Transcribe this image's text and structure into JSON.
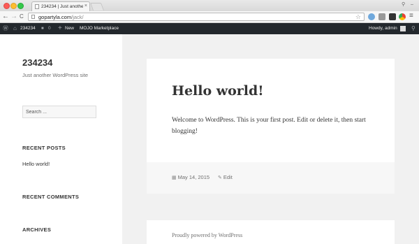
{
  "browser": {
    "tab_title": "234234 | Just another Wo",
    "tab_close": "×",
    "url_host": "gopartyla.com",
    "url_path": "/jack/",
    "back_glyph": "←",
    "forward_glyph": "→",
    "reload_glyph": "C",
    "star_glyph": "☆",
    "menu_glyph": "≡",
    "user_glyph": "⚲",
    "min_glyph": "–"
  },
  "admin_bar": {
    "site_name": "234234",
    "comments_count": "0",
    "new_label": "New",
    "new_plus": "+",
    "marketplace_label": "MOJO Marketplace",
    "howdy": "Howdy, admin",
    "wp_logo_glyph": "Ⓦ",
    "home_glyph": "⌂",
    "comment_glyph": "■",
    "search_glyph": "⚲"
  },
  "sidebar": {
    "site_title": "234234",
    "site_description": "Just another WordPress site",
    "search_placeholder": "Search ...",
    "recent_posts_title": "RECENT POSTS",
    "recent_posts": [
      "Hello world!"
    ],
    "recent_comments_title": "RECENT COMMENTS",
    "archives_title": "ARCHIVES"
  },
  "post": {
    "title": "Hello world!",
    "body": "Welcome to WordPress. This is your first post. Edit or delete it, then start blogging!",
    "date": "May 14, 2015",
    "edit_label": "Edit",
    "date_icon": "▦",
    "edit_icon": "✎"
  },
  "footer": {
    "powered_by": "Proudly powered by WordPress"
  },
  "colors": {
    "admin_bar_bg": "#23282d",
    "page_bg": "#f1f1f1",
    "sidebar_bg": "#ffffff"
  }
}
